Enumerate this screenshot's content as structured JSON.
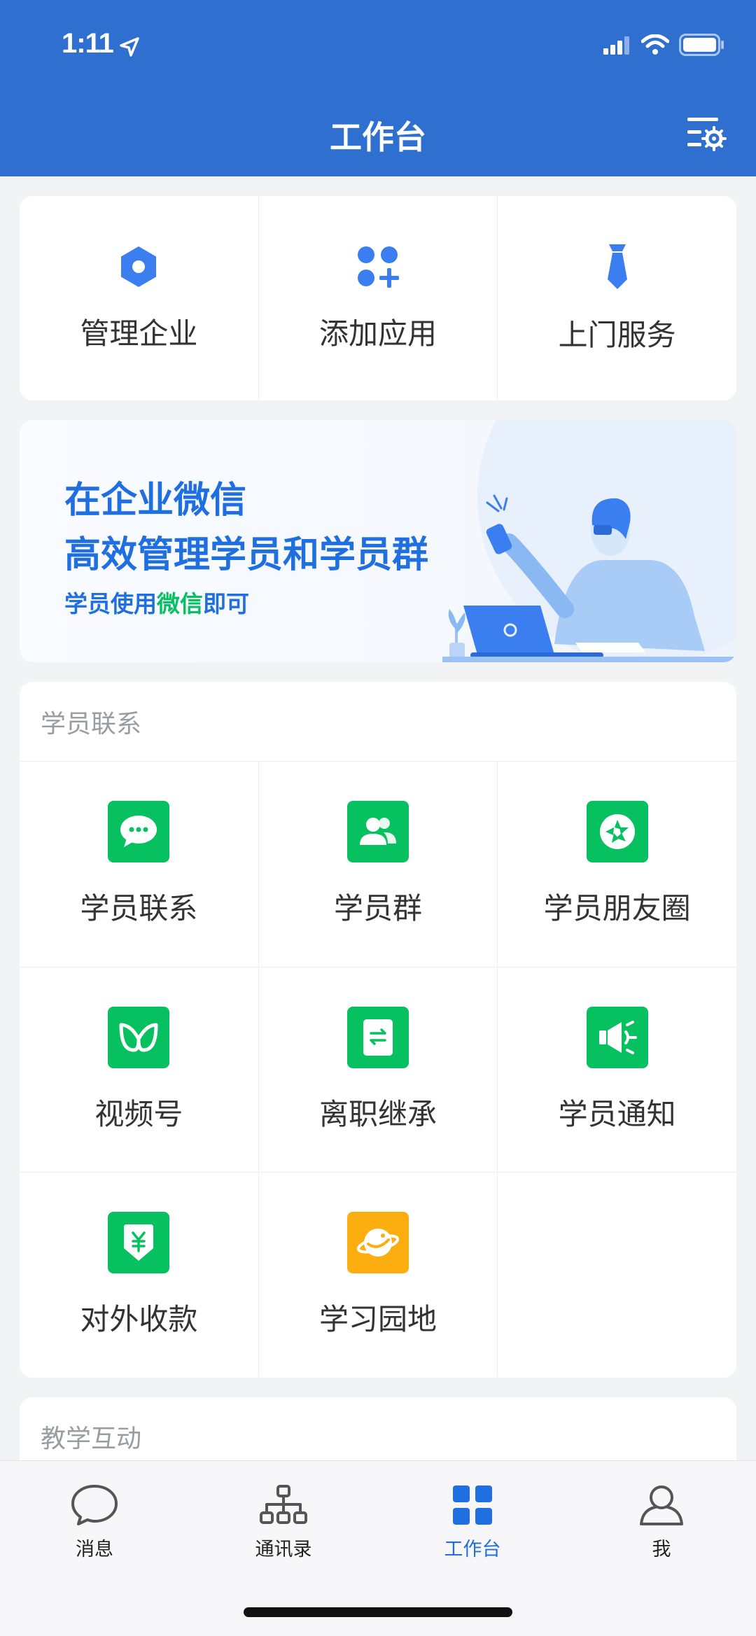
{
  "status_bar": {
    "time": "1:11"
  },
  "header": {
    "title": "工作台"
  },
  "quick_actions": [
    {
      "label": "管理企业",
      "icon": "hexagon-icon"
    },
    {
      "label": "添加应用",
      "icon": "add-app-icon"
    },
    {
      "label": "上门服务",
      "icon": "tie-icon"
    }
  ],
  "banner": {
    "line1": "在企业微信",
    "line2": "高效管理学员和学员群",
    "sub_prefix": "学员使用",
    "sub_highlight": "微信",
    "sub_suffix": "即可"
  },
  "student_section": {
    "title": "学员联系",
    "apps": [
      {
        "label": "学员联系",
        "icon": "chat-bubble-icon",
        "color": "#07c160"
      },
      {
        "label": "学员群",
        "icon": "group-icon",
        "color": "#07c160"
      },
      {
        "label": "学员朋友圈",
        "icon": "moments-icon",
        "color": "#07c160"
      },
      {
        "label": "视频号",
        "icon": "channels-icon",
        "color": "#07c160"
      },
      {
        "label": "离职继承",
        "icon": "transfer-doc-icon",
        "color": "#07c160"
      },
      {
        "label": "学员通知",
        "icon": "megaphone-icon",
        "color": "#07c160"
      },
      {
        "label": "对外收款",
        "icon": "payment-icon",
        "color": "#07c160"
      },
      {
        "label": "学习园地",
        "icon": "planet-icon",
        "color": "#fcae10"
      }
    ]
  },
  "teaching_section": {
    "title": "教学互动"
  },
  "tabbar": {
    "tabs": [
      {
        "label": "消息",
        "icon": "message-icon",
        "active": false
      },
      {
        "label": "通讯录",
        "icon": "contacts-icon",
        "active": false
      },
      {
        "label": "工作台",
        "icon": "workbench-icon",
        "active": true
      },
      {
        "label": "我",
        "icon": "profile-icon",
        "active": false
      }
    ]
  },
  "colors": {
    "header_bg": "#2f6fd0",
    "accent": "#1f6fe0",
    "wechat_green": "#07c160",
    "orange": "#fcae10"
  }
}
